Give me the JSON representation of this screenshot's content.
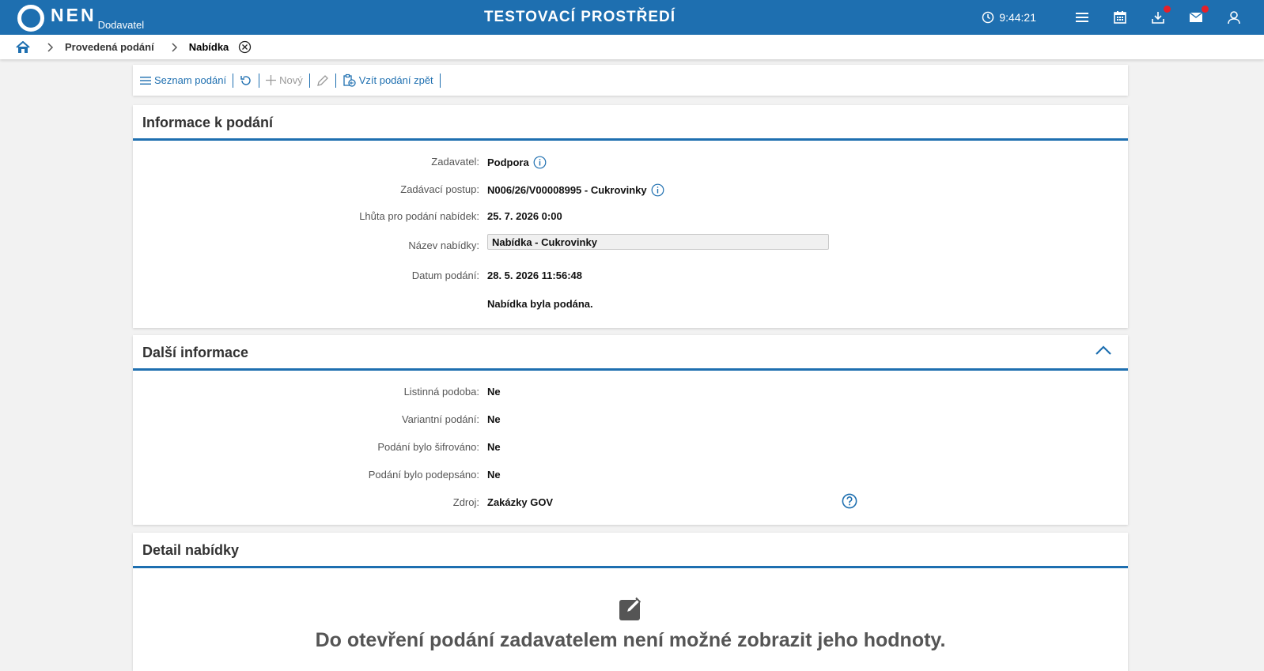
{
  "header": {
    "logo_text": "NEN",
    "logo_sub": "Dodavatel",
    "environment_title": "TESTOVACÍ PROSTŘEDÍ",
    "time": "9:44:21",
    "colors": {
      "bar": "#1e6fb0",
      "badge": "#e5202a"
    }
  },
  "breadcrumb": {
    "items": [
      "Provedená podání",
      "Nabídka"
    ]
  },
  "toolbar": {
    "list_label": "Seznam podání",
    "new_label": "Nový",
    "withdraw_label": "Vzít podání zpět"
  },
  "info_panel": {
    "title": "Informace k podání",
    "fields": [
      {
        "label": "Zadavatel:",
        "value": "Podpora"
      },
      {
        "label": "Zadávací postup:",
        "value": "N006/26/V00008995 - Cukrovinky"
      },
      {
        "label": "Lhůta pro podání nabídek:",
        "value": "25. 7. 2026 0:00"
      },
      {
        "label": "Název nabídky:",
        "value": "Nabídka - Cukrovinky"
      },
      {
        "label": "Datum podání:",
        "value": "28. 5. 2026 11:56:48"
      }
    ],
    "status": "Nabídka byla podána."
  },
  "more_panel": {
    "title": "Další informace",
    "fields": [
      {
        "label": "Listinná podoba:",
        "value": "Ne"
      },
      {
        "label": "Variantní podání:",
        "value": "Ne"
      },
      {
        "label": "Podání bylo šifrováno:",
        "value": "Ne"
      },
      {
        "label": "Podání bylo podepsáno:",
        "value": "Ne"
      },
      {
        "label": "Zdroj:",
        "value": "Zakázky GOV"
      }
    ]
  },
  "detail_panel": {
    "title": "Detail nabídky",
    "message": "Do otevření podání zadavatelem není možné zobrazit jeho hodnoty."
  }
}
